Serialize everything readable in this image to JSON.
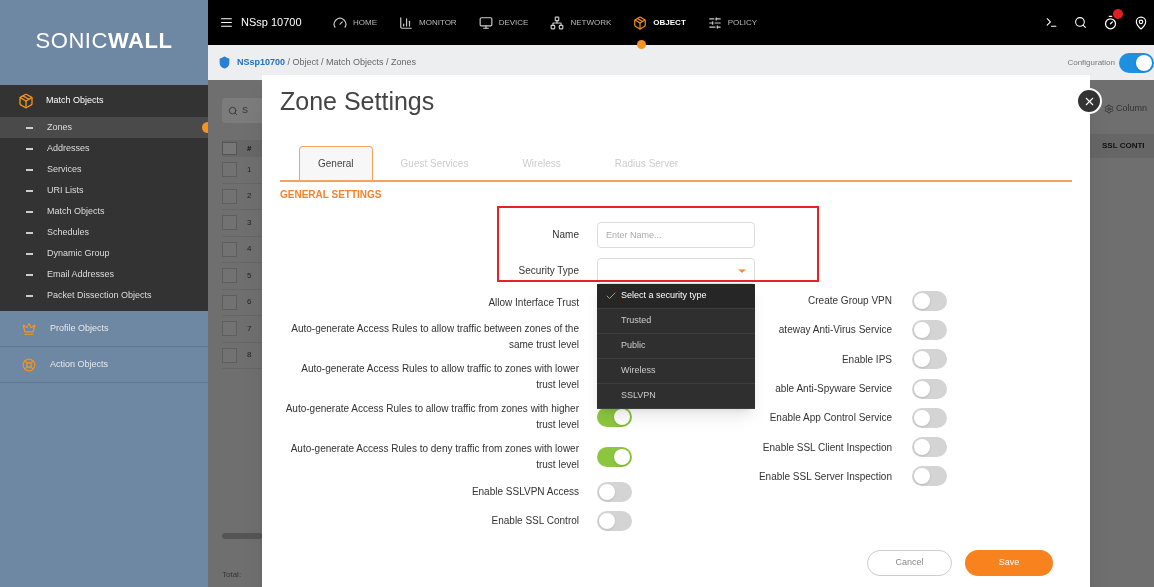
{
  "logo": "SONIC**WALL**",
  "sidebar": {
    "section": "Match Objects",
    "items": [
      {
        "label": "Zones",
        "selected": true
      },
      {
        "label": "Addresses",
        "selected": false
      },
      {
        "label": "Services",
        "selected": false
      },
      {
        "label": "URI Lists",
        "selected": false
      },
      {
        "label": "Match Objects",
        "selected": false
      },
      {
        "label": "Schedules",
        "selected": false
      },
      {
        "label": "Dynamic Group",
        "selected": false
      },
      {
        "label": "Email Addresses",
        "selected": false
      },
      {
        "label": "Packet Dissection Objects",
        "selected": false
      }
    ],
    "groups": [
      {
        "label": "Profile Objects",
        "kind": "profile"
      },
      {
        "label": "Action Objects",
        "kind": "action"
      }
    ]
  },
  "topbar": {
    "device": "NSsp 10700",
    "nav": [
      {
        "label": "HOME",
        "kind": "home",
        "selected": false
      },
      {
        "label": "MONITOR",
        "kind": "monitor",
        "selected": false
      },
      {
        "label": "DEVICE",
        "kind": "device",
        "selected": false
      },
      {
        "label": "NETWORK",
        "kind": "network",
        "selected": false
      },
      {
        "label": "OBJECT",
        "kind": "object",
        "selected": true
      },
      {
        "label": "POLICY",
        "kind": "policy",
        "selected": false
      }
    ]
  },
  "breadcrumb": {
    "root": "NSsp10700",
    "path": " / Object / Match Objects / Zones",
    "mode_label": "Configuration",
    "mode_on": true
  },
  "background": {
    "search": "S",
    "column_header": "#",
    "header_checked": false,
    "rows": [
      {
        "n": "1",
        "checked": false
      },
      {
        "n": "2",
        "checked": false
      },
      {
        "n": "3",
        "checked": false
      },
      {
        "n": "4",
        "checked": false
      },
      {
        "n": "5",
        "checked": false
      },
      {
        "n": "6",
        "checked": false
      },
      {
        "n": "7",
        "checked": false
      },
      {
        "n": "8",
        "checked": false
      }
    ],
    "columns_button": "Column",
    "column_2": "SSL CONTI",
    "footer": "Total:"
  },
  "dialog": {
    "title": "Zone Settings",
    "tabs": [
      {
        "label": "General",
        "selected": true
      },
      {
        "label": "Guest Services",
        "selected": false
      },
      {
        "label": "Wireless",
        "selected": false
      },
      {
        "label": "Radius Server",
        "selected": false
      }
    ],
    "section": "GENERAL SETTINGS",
    "left": [
      {
        "kind": "field",
        "label": "Name",
        "placeholder": "Enter Name..."
      },
      {
        "kind": "select",
        "label": "Security Type",
        "options": [
          {
            "label": "Select a security type",
            "selected": true
          },
          {
            "label": "Trusted",
            "selected": false
          },
          {
            "label": "Public",
            "selected": false
          },
          {
            "label": "Wireless",
            "selected": false
          },
          {
            "label": "SSLVPN",
            "selected": false
          }
        ]
      },
      {
        "kind": "toggle",
        "label": "Allow Interface Trust"
      },
      {
        "kind": "toggle",
        "label": "Auto-generate Access Rules to allow traffic between zones of the same trust level"
      },
      {
        "kind": "toggle",
        "label": "Auto-generate Access Rules to allow traffic to zones with lower trust level"
      },
      {
        "kind": "toggle",
        "label": "Auto-generate Access Rules to allow traffic from zones with higher trust level",
        "on": true
      },
      {
        "kind": "toggle",
        "label": "Auto-generate Access Rules to deny traffic from zones with lower trust level",
        "on": true
      },
      {
        "kind": "toggle",
        "label": "Enable SSLVPN Access",
        "on": false
      },
      {
        "kind": "toggle",
        "label": "Enable SSL Control",
        "on": false
      }
    ],
    "right": [
      {
        "label": "Create Group VPN",
        "on": false
      },
      {
        "label": "ateway Anti-Virus Service",
        "on": false
      },
      {
        "label": "Enable IPS",
        "on": false
      },
      {
        "label": "able Anti-Spyware Service",
        "on": false
      },
      {
        "label": "Enable App Control Service",
        "on": false
      },
      {
        "label": "Enable SSL Client Inspection",
        "on": false
      },
      {
        "label": "Enable SSL Server Inspection",
        "on": false
      }
    ],
    "buttons": [
      {
        "label": "Cancel",
        "kind": "secondary"
      },
      {
        "label": "Save",
        "kind": "primary"
      }
    ]
  }
}
